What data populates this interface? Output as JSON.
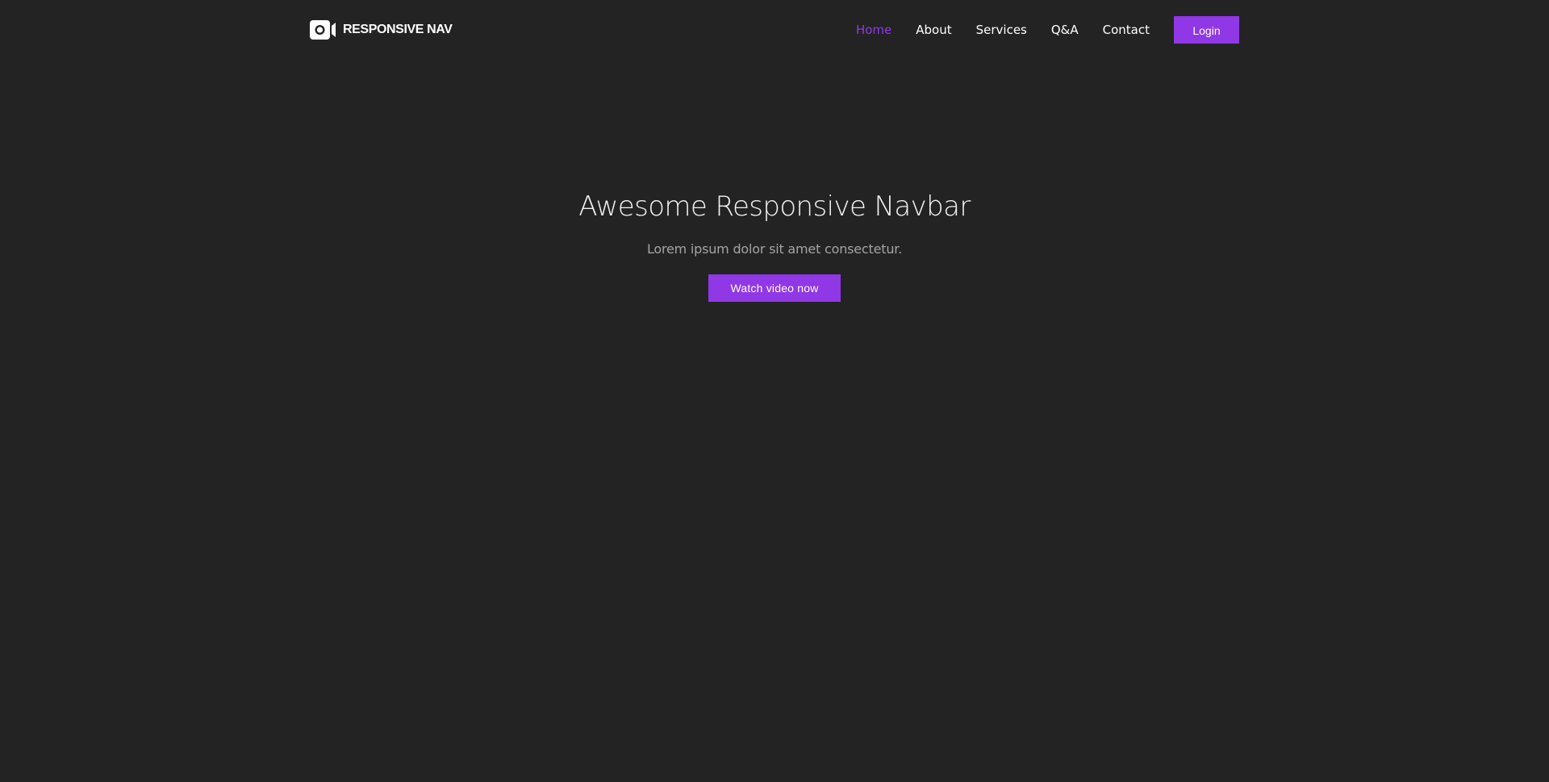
{
  "brand": {
    "name": "RESPONSIVE NAV",
    "icon": "video-camera-icon"
  },
  "nav": {
    "items": [
      {
        "label": "Home",
        "active": true
      },
      {
        "label": "About",
        "active": false
      },
      {
        "label": "Services",
        "active": false
      },
      {
        "label": "Q&A",
        "active": false
      },
      {
        "label": "Contact",
        "active": false
      }
    ],
    "login_label": "Login"
  },
  "hero": {
    "title": "Awesome Responsive Navbar",
    "subtitle": "Lorem ipsum dolor sit amet consectetur.",
    "cta_label": "Watch video now"
  },
  "colors": {
    "background": "#232323",
    "accent": "#9038e6",
    "text": "#ffffff",
    "muted_text": "#a4a4a4"
  }
}
